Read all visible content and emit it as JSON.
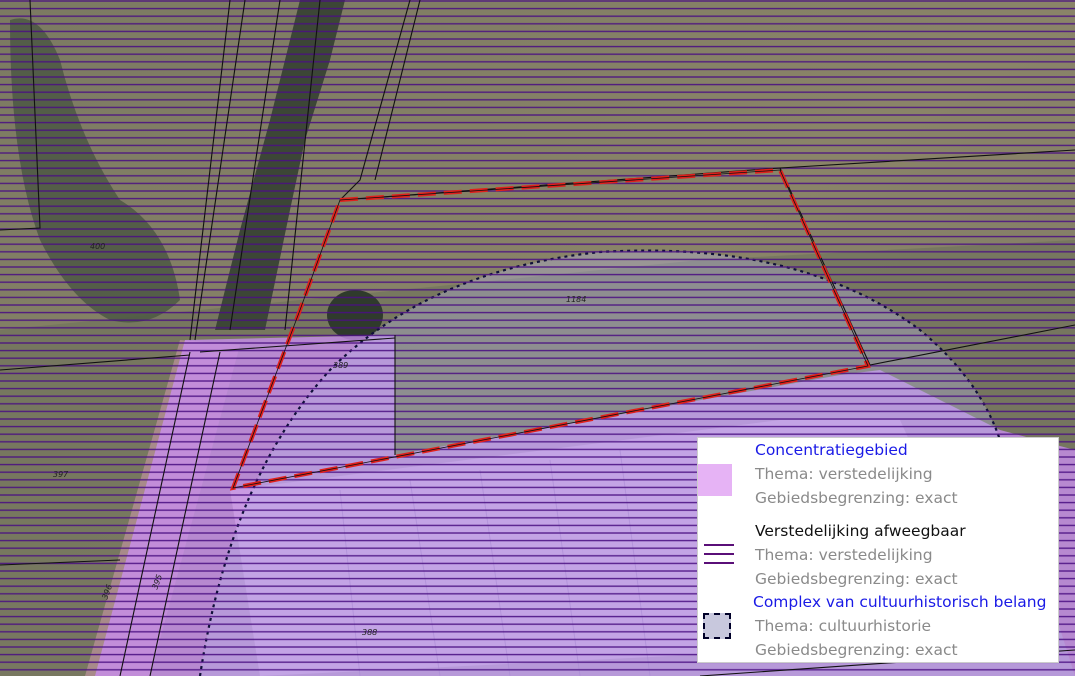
{
  "map": {
    "parcel_numbers": [
      "400",
      "1184",
      "389",
      "397",
      "396",
      "395",
      "388"
    ]
  },
  "legend": {
    "items": [
      {
        "title": "Concentratiegebied",
        "lines": [
          "Thema: verstedelijking",
          "Gebiedsbegrenzing: exact"
        ],
        "symbol": "filled-purple-square",
        "title_color": "#1a1ae6",
        "symbol_color": "#e6b3f5"
      },
      {
        "title": "Verstedelijking afweegbaar",
        "lines": [
          "Thema: verstedelijking",
          "Gebiedsbegrenzing: exact"
        ],
        "symbol": "horizontal-lines",
        "title_color": "#111111",
        "symbol_color": "#5a0f78"
      },
      {
        "title": "Complex van cultuurhistorisch belang",
        "lines": [
          "Thema: cultuurhistorie",
          "Gebiedsbegrenzing: exact"
        ],
        "symbol": "dashed-square",
        "title_color": "#1a1ae6",
        "symbol_color": "#c8c8dd"
      }
    ]
  },
  "colors": {
    "plan_boundary": "#e0201c",
    "hatch_lines": "#4a0f82",
    "concentratie_fill": "#c98ef0",
    "complex_outline": "#10103a"
  }
}
